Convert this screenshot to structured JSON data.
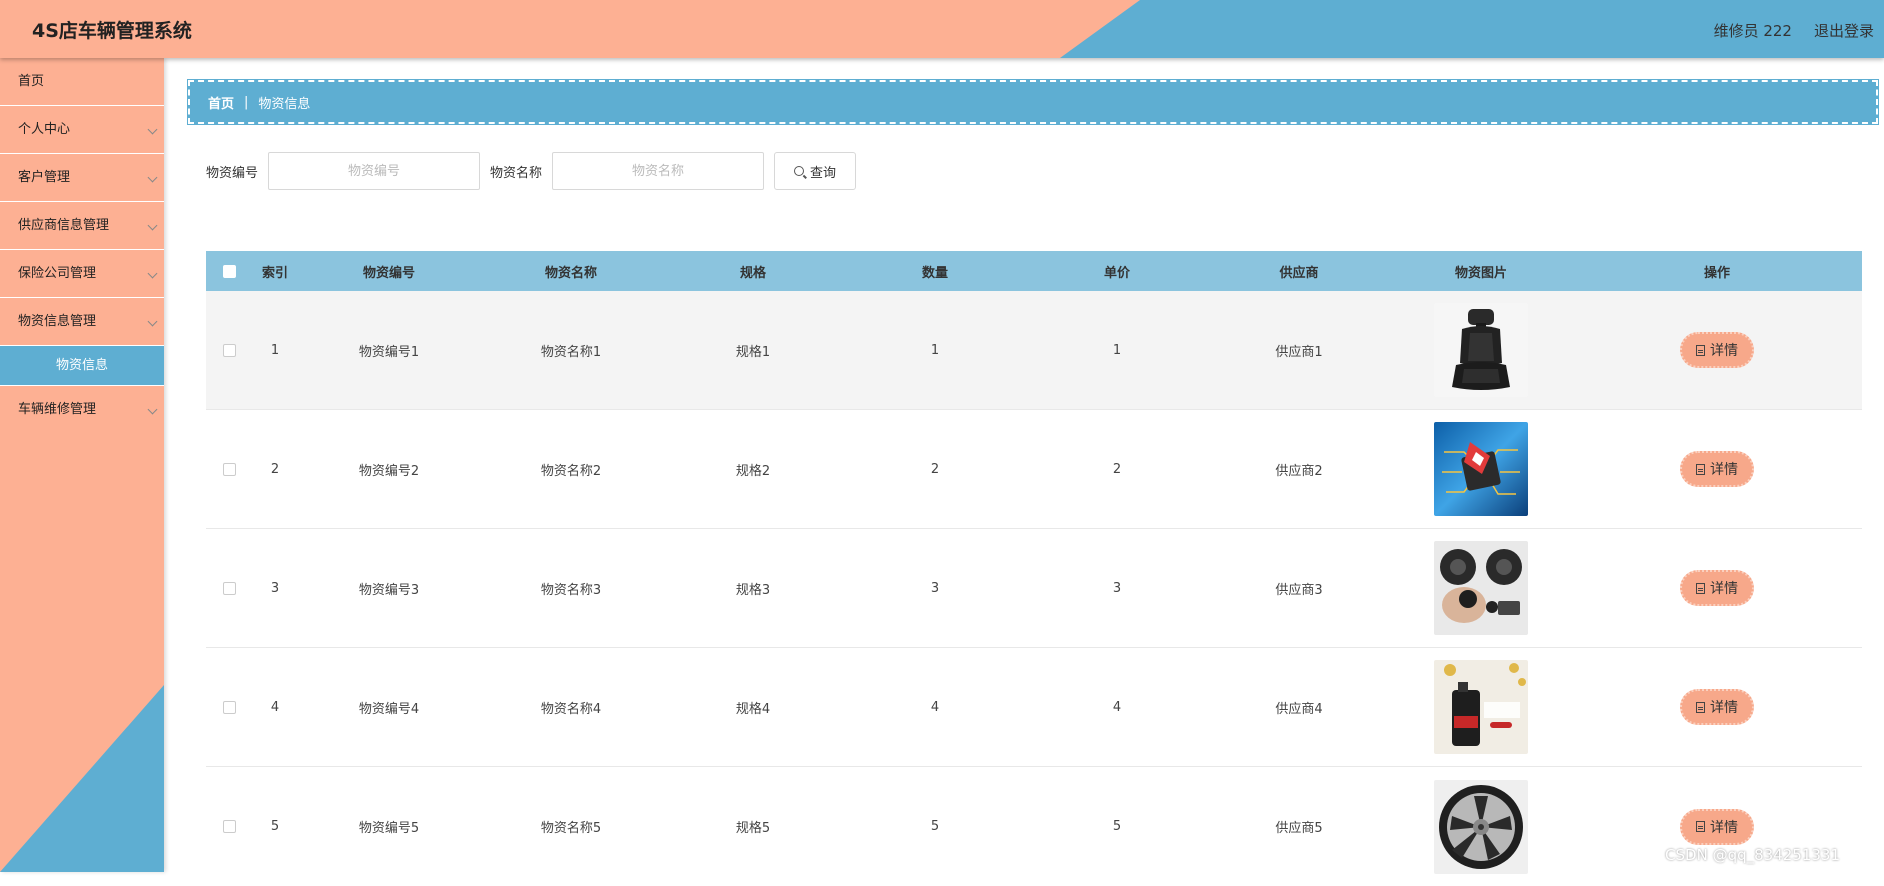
{
  "header": {
    "title": "4S店车辆管理系统",
    "user": "维修员 222",
    "logout": "退出登录"
  },
  "sidebar": {
    "items": [
      {
        "label": "首页"
      },
      {
        "label": "个人中心"
      },
      {
        "label": "客户管理"
      },
      {
        "label": "供应商信息管理"
      },
      {
        "label": "保险公司管理"
      },
      {
        "label": "物资信息管理"
      },
      {
        "label": "物资信息"
      },
      {
        "label": "车辆维修管理"
      }
    ]
  },
  "breadcrumb": {
    "home": "首页",
    "current": "物资信息"
  },
  "search": {
    "code_label": "物资编号",
    "code_placeholder": "物资编号",
    "name_label": "物资名称",
    "name_placeholder": "物资名称",
    "button": "查询"
  },
  "table": {
    "headers": [
      "索引",
      "物资编号",
      "物资名称",
      "规格",
      "数量",
      "单价",
      "供应商",
      "物资图片",
      "操作"
    ],
    "rows": [
      {
        "index": "1",
        "code": "物资编号1",
        "name": "物资名称1",
        "spec": "规格1",
        "qty": "1",
        "price": "1",
        "supplier": "供应商1",
        "image": "car-seat-image",
        "action": "详情"
      },
      {
        "index": "2",
        "code": "物资编号2",
        "name": "物资名称2",
        "spec": "规格2",
        "qty": "2",
        "price": "2",
        "supplier": "供应商2",
        "image": "chip-image",
        "action": "详情"
      },
      {
        "index": "3",
        "code": "物资编号3",
        "name": "物资名称3",
        "spec": "规格3",
        "qty": "3",
        "price": "3",
        "supplier": "供应商3",
        "image": "speakers-image",
        "action": "详情"
      },
      {
        "index": "4",
        "code": "物资编号4",
        "name": "物资名称4",
        "spec": "规格4",
        "qty": "4",
        "price": "4",
        "supplier": "供应商4",
        "image": "engine-oil-image",
        "action": "详情"
      },
      {
        "index": "5",
        "code": "物资编号5",
        "name": "物资名称5",
        "spec": "规格5",
        "qty": "5",
        "price": "5",
        "supplier": "供应商5",
        "image": "wheel-rim-image",
        "action": "详情"
      }
    ]
  },
  "watermark": "CSDN @qq_834251331",
  "colors": {
    "peach": "#fdb093",
    "blue": "#5eaed2",
    "table_header": "#8bc4de",
    "button": "#f7a88a"
  }
}
